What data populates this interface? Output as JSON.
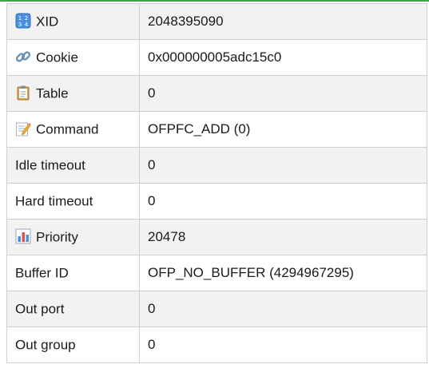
{
  "rows": [
    {
      "key": "XID",
      "value": "2048395090",
      "icon": "numbers-keycap-icon"
    },
    {
      "key": "Cookie",
      "value": "0x000000005adc15c0",
      "icon": "link-icon"
    },
    {
      "key": "Table",
      "value": "0",
      "icon": "clipboard-icon"
    },
    {
      "key": "Command",
      "value": "OFPFC_ADD (0)",
      "icon": "memo-icon"
    },
    {
      "key": "Idle timeout",
      "value": "0",
      "icon": ""
    },
    {
      "key": "Hard timeout",
      "value": "0",
      "icon": ""
    },
    {
      "key": "Priority",
      "value": "20478",
      "icon": "bar-chart-icon"
    },
    {
      "key": "Buffer ID",
      "value": "OFP_NO_BUFFER (4294967295)",
      "icon": ""
    },
    {
      "key": "Out port",
      "value": "0",
      "icon": ""
    },
    {
      "key": "Out group",
      "value": "0",
      "icon": ""
    }
  ],
  "colors": {
    "accent": "#3fa34d",
    "row_alt": "#f2f2f2",
    "border": "#cfcfcf"
  }
}
